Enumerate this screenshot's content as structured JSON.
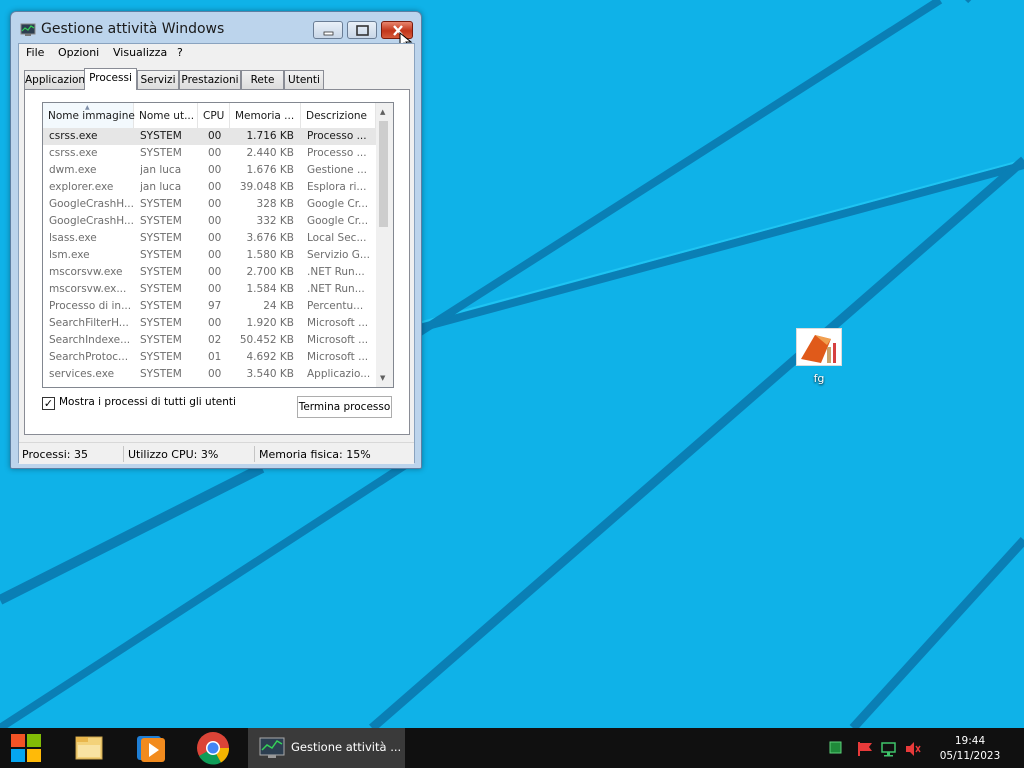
{
  "window": {
    "title": "Gestione attività Windows",
    "menu": [
      "File",
      "Opzioni",
      "Visualizza",
      "?"
    ],
    "tabs": [
      "Applicazioni",
      "Processi",
      "Servizi",
      "Prestazioni",
      "Rete",
      "Utenti"
    ],
    "active_tab": "Processi",
    "columns": [
      "Nome immagine",
      "Nome ut...",
      "CPU",
      "Memoria ...",
      "Descrizione"
    ],
    "rows": [
      {
        "name": "csrss.exe",
        "user": "SYSTEM",
        "cpu": "00",
        "mem": "1.716 KB",
        "desc": "Processo ..."
      },
      {
        "name": "csrss.exe",
        "user": "SYSTEM",
        "cpu": "00",
        "mem": "2.440 KB",
        "desc": "Processo ..."
      },
      {
        "name": "dwm.exe",
        "user": "jan luca",
        "cpu": "00",
        "mem": "1.676 KB",
        "desc": "Gestione ..."
      },
      {
        "name": "explorer.exe",
        "user": "jan luca",
        "cpu": "00",
        "mem": "39.048 KB",
        "desc": "Esplora ri..."
      },
      {
        "name": "GoogleCrashH...",
        "user": "SYSTEM",
        "cpu": "00",
        "mem": "328 KB",
        "desc": "Google Cr..."
      },
      {
        "name": "GoogleCrashH...",
        "user": "SYSTEM",
        "cpu": "00",
        "mem": "332 KB",
        "desc": "Google Cr..."
      },
      {
        "name": "lsass.exe",
        "user": "SYSTEM",
        "cpu": "00",
        "mem": "3.676 KB",
        "desc": "Local Sec..."
      },
      {
        "name": "lsm.exe",
        "user": "SYSTEM",
        "cpu": "00",
        "mem": "1.580 KB",
        "desc": "Servizio G..."
      },
      {
        "name": "mscorsvw.exe",
        "user": "SYSTEM",
        "cpu": "00",
        "mem": "2.700 KB",
        "desc": ".NET Run..."
      },
      {
        "name": "mscorsvw.ex...",
        "user": "SYSTEM",
        "cpu": "00",
        "mem": "1.584 KB",
        "desc": ".NET Run..."
      },
      {
        "name": "Processo di in...",
        "user": "SYSTEM",
        "cpu": "97",
        "mem": "24 KB",
        "desc": "Percentu..."
      },
      {
        "name": "SearchFilterH...",
        "user": "SYSTEM",
        "cpu": "00",
        "mem": "1.920 KB",
        "desc": "Microsoft ..."
      },
      {
        "name": "SearchIndexe...",
        "user": "SYSTEM",
        "cpu": "02",
        "mem": "50.452 KB",
        "desc": "Microsoft ..."
      },
      {
        "name": "SearchProtoc...",
        "user": "SYSTEM",
        "cpu": "01",
        "mem": "4.692 KB",
        "desc": "Microsoft ..."
      },
      {
        "name": "services.exe",
        "user": "SYSTEM",
        "cpu": "00",
        "mem": "3.540 KB",
        "desc": "Applicazio..."
      }
    ],
    "show_all_label": "Mostra i processi di tutti gli utenti",
    "show_all_checked": true,
    "end_process_label": "Termina processo",
    "status": {
      "processes": "Processi: 35",
      "cpu": "Utilizzo CPU: 3%",
      "memory": "Memoria fisica: 15%"
    }
  },
  "desktop": {
    "icon_label": "fg"
  },
  "taskbar": {
    "active_app_label": "Gestione attività ...",
    "time": "19:44",
    "date": "05/11/2023",
    "pinned_icons": [
      "windows-start-icon",
      "file-explorer-icon",
      "media-player-icon",
      "chrome-icon"
    ],
    "tray_icons": [
      "green-square-icon",
      "action-center-flag-icon",
      "network-icon",
      "volume-muted-icon"
    ]
  },
  "colors": {
    "desktop": "#0fb2e8",
    "taskbar": "#101010",
    "close_button": "#c2351a"
  }
}
